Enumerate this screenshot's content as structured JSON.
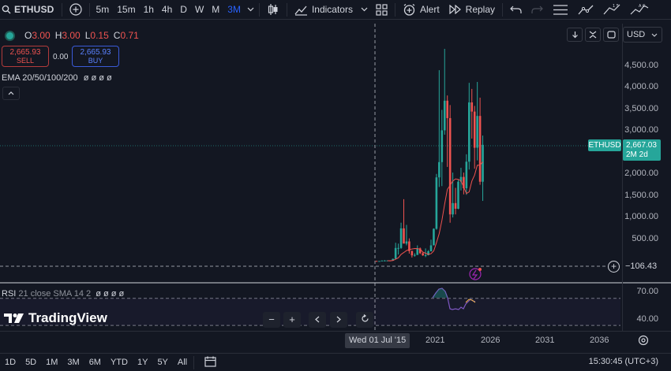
{
  "toolbar": {
    "symbol": "ETHUSD",
    "intervals": [
      "5m",
      "15m",
      "1h",
      "4h",
      "D",
      "W",
      "M",
      "3M"
    ],
    "active_interval": "3M",
    "indicators_label": "Indicators",
    "alert_label": "Alert",
    "replay_label": "Replay"
  },
  "legend": {
    "o_key": "O",
    "o_val": "3.00",
    "h_key": "H",
    "h_val": "3.00",
    "l_key": "L",
    "l_val": "0.15",
    "c_key": "C",
    "c_val": "0.71"
  },
  "trade": {
    "sell_price": "2,665.93",
    "sell_label": "SELL",
    "spread": "0.00",
    "buy_price": "2,665.93",
    "buy_label": "BUY"
  },
  "ema_label": "EMA 20/50/100/200",
  "ema_values": "ø ø ø ø",
  "currency": "USD",
  "price_axis": [
    "4,500.00",
    "4,000.00",
    "3,500.00",
    "3,000.00",
    "2,000.00",
    "1,500.00",
    "1,000.00",
    "500.00"
  ],
  "last_price": {
    "symbol_tag": "ETHUSD",
    "price": "2,667.03",
    "countdown": "2M 2d"
  },
  "crosshair_price": "−106.43",
  "rsi": {
    "name": "RSI",
    "params": "21 close SMA 14 2",
    "values": "ø ø ø ø",
    "axis": [
      "70.00",
      "40.00"
    ]
  },
  "logo_text": "TradingView",
  "time_axis": {
    "crosshair": "Wed 01 Jul '15",
    "labels": [
      "2021",
      "2026",
      "2031",
      "2036"
    ]
  },
  "ranges": [
    "1D",
    "5D",
    "1M",
    "3M",
    "6M",
    "YTD",
    "1Y",
    "5Y",
    "All"
  ],
  "clock": "15:30:45 (UTC+3)",
  "colors": {
    "up": "#26a69a",
    "down": "#ef5350",
    "accent": "#2962ff",
    "rsi_line": "#7e57c2",
    "ma_line": "#ef5350"
  },
  "chart_data": {
    "type": "candlestick",
    "symbol": "ETHUSD",
    "interval": "3M",
    "ylim": [
      -200,
      4900
    ],
    "x_range": [
      "2015-07",
      "2036"
    ],
    "candles": [
      {
        "t": "2015-07",
        "o": 3.0,
        "h": 3.0,
        "l": 0.15,
        "c": 0.71
      },
      {
        "t": "2015-10",
        "o": 0.7,
        "h": 1.2,
        "l": 0.4,
        "c": 0.9
      },
      {
        "t": "2016-01",
        "o": 0.9,
        "h": 14,
        "l": 0.9,
        "c": 11
      },
      {
        "t": "2016-04",
        "o": 11,
        "h": 21,
        "l": 7,
        "c": 12
      },
      {
        "t": "2016-07",
        "o": 12,
        "h": 15,
        "l": 6,
        "c": 13
      },
      {
        "t": "2016-10",
        "o": 13,
        "h": 14,
        "l": 7,
        "c": 8
      },
      {
        "t": "2017-01",
        "o": 8,
        "h": 55,
        "l": 8,
        "c": 50
      },
      {
        "t": "2017-04",
        "o": 50,
        "h": 420,
        "l": 48,
        "c": 300
      },
      {
        "t": "2017-07",
        "o": 300,
        "h": 400,
        "l": 150,
        "c": 300
      },
      {
        "t": "2017-10",
        "o": 300,
        "h": 880,
        "l": 280,
        "c": 750
      },
      {
        "t": "2018-01",
        "o": 750,
        "h": 1420,
        "l": 560,
        "c": 400
      },
      {
        "t": "2018-04",
        "o": 400,
        "h": 830,
        "l": 360,
        "c": 450
      },
      {
        "t": "2018-07",
        "o": 450,
        "h": 520,
        "l": 170,
        "c": 230
      },
      {
        "t": "2018-10",
        "o": 230,
        "h": 240,
        "l": 80,
        "c": 130
      },
      {
        "t": "2019-01",
        "o": 130,
        "h": 180,
        "l": 100,
        "c": 140
      },
      {
        "t": "2019-04",
        "o": 140,
        "h": 360,
        "l": 140,
        "c": 290
      },
      {
        "t": "2019-07",
        "o": 290,
        "h": 310,
        "l": 160,
        "c": 180
      },
      {
        "t": "2019-10",
        "o": 180,
        "h": 200,
        "l": 120,
        "c": 130
      },
      {
        "t": "2020-01",
        "o": 130,
        "h": 290,
        "l": 90,
        "c": 135
      },
      {
        "t": "2020-04",
        "o": 135,
        "h": 250,
        "l": 130,
        "c": 225
      },
      {
        "t": "2020-07",
        "o": 225,
        "h": 490,
        "l": 220,
        "c": 360
      },
      {
        "t": "2020-10",
        "o": 360,
        "h": 750,
        "l": 360,
        "c": 740
      },
      {
        "t": "2021-01",
        "o": 740,
        "h": 2000,
        "l": 720,
        "c": 1920
      },
      {
        "t": "2021-04",
        "o": 1920,
        "h": 4380,
        "l": 1700,
        "c": 2270
      },
      {
        "t": "2021-07",
        "o": 2270,
        "h": 3470,
        "l": 1720,
        "c": 3000
      },
      {
        "t": "2021-10",
        "o": 3000,
        "h": 4870,
        "l": 2900,
        "c": 3680
      },
      {
        "t": "2022-01",
        "o": 3680,
        "h": 3800,
        "l": 2160,
        "c": 3280
      },
      {
        "t": "2022-04",
        "o": 3280,
        "h": 3580,
        "l": 880,
        "c": 1070
      },
      {
        "t": "2022-07",
        "o": 1070,
        "h": 2030,
        "l": 1000,
        "c": 1330
      },
      {
        "t": "2022-10",
        "o": 1330,
        "h": 1680,
        "l": 1070,
        "c": 1200
      },
      {
        "t": "2023-01",
        "o": 1200,
        "h": 1860,
        "l": 1190,
        "c": 1820
      },
      {
        "t": "2023-04",
        "o": 1820,
        "h": 2140,
        "l": 1620,
        "c": 1930
      },
      {
        "t": "2023-07",
        "o": 1930,
        "h": 2030,
        "l": 1530,
        "c": 1670
      },
      {
        "t": "2023-10",
        "o": 1670,
        "h": 2450,
        "l": 1520,
        "c": 2280
      },
      {
        "t": "2024-01",
        "o": 2280,
        "h": 4090,
        "l": 2100,
        "c": 3640
      },
      {
        "t": "2024-04",
        "o": 3640,
        "h": 3950,
        "l": 2810,
        "c": 3430
      },
      {
        "t": "2024-07",
        "o": 3430,
        "h": 3560,
        "l": 2120,
        "c": 2600
      },
      {
        "t": "2024-10",
        "o": 2600,
        "h": 4110,
        "l": 2310,
        "c": 3330
      },
      {
        "t": "2025-01",
        "o": 3330,
        "h": 3750,
        "l": 1750,
        "c": 1820
      },
      {
        "t": "2025-04",
        "o": 1820,
        "h": 2880,
        "l": 1380,
        "c": 2667.03
      }
    ],
    "rsi_range": [
      30,
      80
    ],
    "rsi_levels": [
      70,
      40
    ]
  }
}
